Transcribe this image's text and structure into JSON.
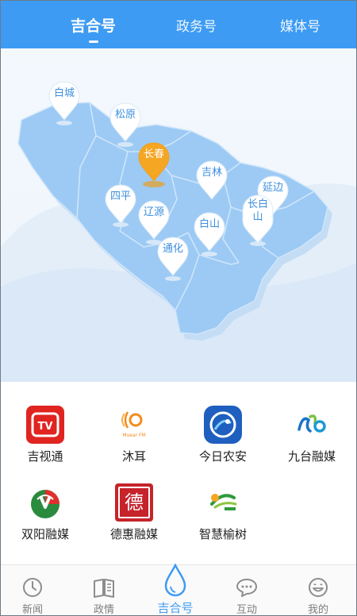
{
  "tabs": [
    {
      "label": "吉合号",
      "active": true
    },
    {
      "label": "政务号",
      "active": false
    },
    {
      "label": "媒体号",
      "active": false
    }
  ],
  "map": {
    "region_color": "#9ccaf4",
    "active_color": "#f5a623",
    "cities": [
      {
        "label": "白城"
      },
      {
        "label": "松原"
      },
      {
        "label": "长春",
        "active": true
      },
      {
        "label": "吉林"
      },
      {
        "label": "延边"
      },
      {
        "label": "四平"
      },
      {
        "label": "辽源"
      },
      {
        "label": "白山"
      },
      {
        "label": "长白山"
      },
      {
        "label": "通化"
      }
    ]
  },
  "apps": [
    {
      "name": "吉视通",
      "icon": "jishitong-icon"
    },
    {
      "name": "沐耳",
      "icon": "muer-icon",
      "icon_text": "Muear FM"
    },
    {
      "name": "今日农安",
      "icon": "nongan-icon"
    },
    {
      "name": "九台融媒",
      "icon": "jiutai-icon"
    },
    {
      "name": "双阳融媒",
      "icon": "shuangyang-icon"
    },
    {
      "name": "德惠融媒",
      "icon": "dehui-icon",
      "icon_text": "德"
    },
    {
      "name": "智慧榆树",
      "icon": "yushu-icon"
    }
  ],
  "bottom_nav": [
    {
      "label": "新闻",
      "icon": "clock-icon"
    },
    {
      "label": "政情",
      "icon": "book-icon"
    },
    {
      "label": "吉合号",
      "icon": "water-drop-icon",
      "active": true
    },
    {
      "label": "互动",
      "icon": "chat-bubble-icon"
    },
    {
      "label": "我的",
      "icon": "smiley-icon"
    }
  ],
  "colors": {
    "accent": "#3d9bf3",
    "pin_text": "#3d8fe0"
  }
}
